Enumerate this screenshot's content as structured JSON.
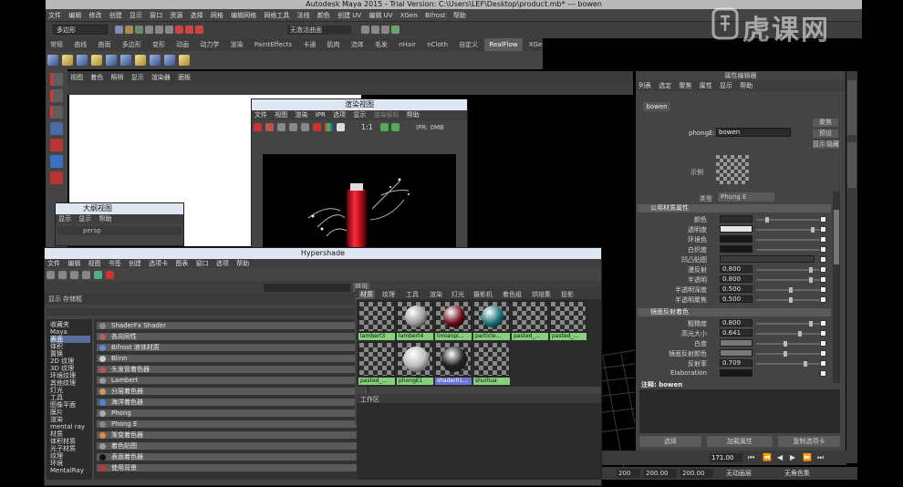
{
  "window": {
    "title": "Autodesk Maya 2015 - Trial Version: C:\\Users\\LEF\\Desktop\\product.mb* --- bowen"
  },
  "menu": [
    "文件",
    "编辑",
    "修改",
    "创建",
    "显示",
    "窗口",
    "资源",
    "选择",
    "网格",
    "编辑网格",
    "网格工具",
    "法线",
    "颜色",
    "创建 UV",
    "编辑 UV",
    "XGen",
    "Bifrost",
    "帮助"
  ],
  "status": {
    "mode": "多边形",
    "field": "无激活曲面"
  },
  "shelf_tabs": [
    "常规",
    "曲线",
    "曲面",
    "多边形",
    "变形",
    "动画",
    "动力学",
    "渲染",
    "PaintEffects",
    "卡通",
    "肌肉",
    "流体",
    "毛发",
    "nHair",
    "nCloth",
    "自定义",
    "RealFlow",
    "XGen"
  ],
  "shelf_active": "RealFlow",
  "viewport_menu": [
    "视图",
    "着色",
    "照明",
    "显示",
    "渲染器",
    "面板"
  ],
  "render_view": {
    "title": "渲染视图",
    "menu": [
      "文件",
      "视图",
      "渲染",
      "IPR",
      "选项",
      "显示",
      "渲染层标",
      "帮助"
    ],
    "ratio": "1:1",
    "ipr": "IPR: 0MB"
  },
  "outliner": {
    "title": "大纲视图",
    "menu": [
      "显示",
      "显示",
      "帮助"
    ],
    "item": "persp"
  },
  "hypershade": {
    "title": "Hypershade",
    "menu": [
      "文件",
      "编辑",
      "视图",
      "书签",
      "创建",
      "选项卡",
      "图表",
      "窗口",
      "选项",
      "帮助"
    ],
    "show_button": "显示",
    "tabs_left": [
      "显示",
      "存储框"
    ],
    "categories": [
      "收藏夹",
      "Maya",
      "表面",
      "体积",
      "置换",
      "2D 纹理",
      "3D 纹理",
      "环境纹理",
      "其他纹理",
      "灯光",
      "工具",
      "图像平面",
      "膜片",
      "渲染",
      "mental ray",
      "材质",
      "体积材质",
      "光子材质",
      "纹理",
      "环境",
      "MentalRay"
    ],
    "nodes": [
      "ShaderFx Shader",
      "各向同性",
      "Bifrost 液体材质",
      "Blinn",
      "头发管着色器",
      "Lambert",
      "分层着色器",
      "海洋着色器",
      "Phong",
      "Phong E",
      "渐变着色器",
      "着色贴图",
      "表面着色器",
      "使用背景"
    ],
    "right_tabs": [
      "材质",
      "纹理",
      "工具",
      "渲染",
      "灯光",
      "摄影机",
      "着色组",
      "烘焙集",
      "投影"
    ],
    "swatches_row1": [
      "lambert3",
      "lambert4",
      "limianpi...",
      "particle...",
      "pasted_...",
      "pasted_..."
    ],
    "swatches_row2": [
      "pasted_...",
      "phongE1",
      "shader01...",
      "shuihua"
    ],
    "work_area": "工作区"
  },
  "attr_editor": {
    "title": "属性编辑器",
    "menu": [
      "列表",
      "选定",
      "聚焦",
      "属性",
      "显示",
      "帮助"
    ],
    "node_tab": "bowen",
    "node_label": "phongE:",
    "node_name": "bowen",
    "buttons": [
      "聚焦",
      "预设",
      "显示",
      "隐藏"
    ],
    "sample_label": "示例",
    "type_label": "类型",
    "type_value": "Phong E",
    "sect_common": "公用材质属性",
    "common": [
      {
        "label": "颜色",
        "value": ""
      },
      {
        "label": "透明度",
        "value": ""
      },
      {
        "label": "环境色",
        "value": ""
      },
      {
        "label": "白炽度",
        "value": ""
      },
      {
        "label": "凹凸贴图",
        "value": ""
      },
      {
        "label": "漫反射",
        "value": "0.800"
      },
      {
        "label": "半透明",
        "value": "0.800"
      },
      {
        "label": "半透明深度",
        "value": "0.500"
      },
      {
        "label": "半透明聚焦",
        "value": "0.500"
      }
    ],
    "sect_spec": "镜面反射着色",
    "spec": [
      {
        "label": "粗糙度",
        "value": "0.800"
      },
      {
        "label": "高光大小",
        "value": "0.641"
      },
      {
        "label": "白度",
        "value": ""
      },
      {
        "label": "镜面反射颜色",
        "value": ""
      },
      {
        "label": "反射率",
        "value": "0.709"
      },
      {
        "label": "Elaboration",
        "value": ""
      }
    ],
    "notes_label": "注释: bowen",
    "bottom_buttons": [
      "选择",
      "加载属性",
      "复制选项卡"
    ]
  },
  "timeline": {
    "frame": "171.00",
    "end1": "200",
    "end2": "200.00",
    "end3": "200.00",
    "anim_layer": "无动画层",
    "char_set": "无角色集"
  },
  "watermark": "虎课网"
}
